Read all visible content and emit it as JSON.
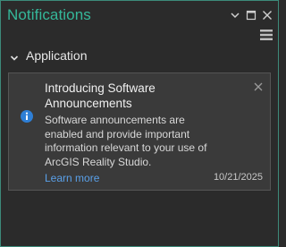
{
  "panel": {
    "title": "Notifications",
    "accent_color": "#35b89a",
    "controls": {
      "dropdown_icon": "chevron-down-icon",
      "maximize_icon": "maximize-icon",
      "close_icon": "close-icon",
      "menu_icon": "hamburger-menu-icon"
    }
  },
  "section": {
    "label": "Application",
    "expanded": true
  },
  "notification": {
    "icon": "info-icon",
    "title": "Introducing Software Announcements",
    "body": "Software announcements are enabled and provide important information relevant to your use of ArcGIS Reality Studio.",
    "link_label": "Learn more",
    "date": "10/21/2025",
    "link_color": "#5aa0e8"
  }
}
